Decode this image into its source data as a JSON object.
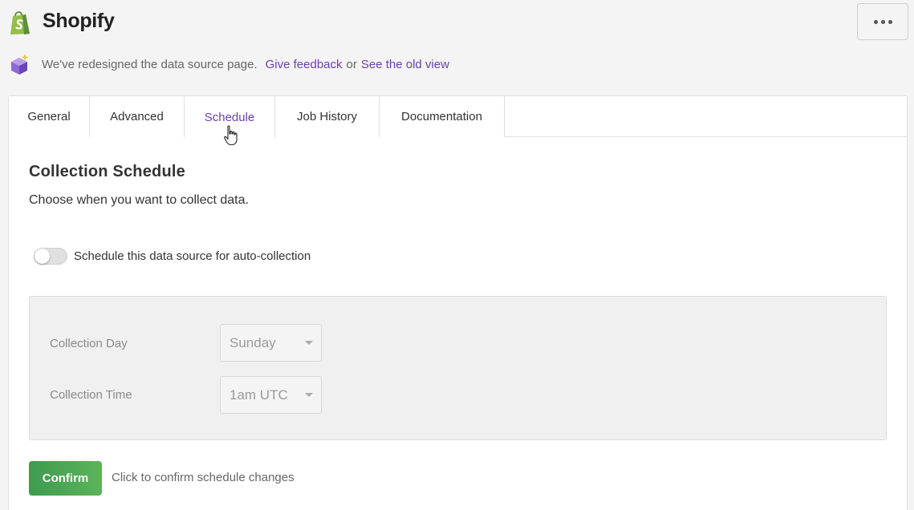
{
  "header": {
    "title": "Shopify",
    "logo_icon": "shopify-bag-icon",
    "more_icon": "ellipsis-icon"
  },
  "notice": {
    "text": "We've redesigned the data source page.",
    "feedback_link": "Give feedback",
    "or_text": "or",
    "old_view_link": "See the old view",
    "icon": "package-sparkle-icon"
  },
  "tabs": [
    {
      "label": "General"
    },
    {
      "label": "Advanced"
    },
    {
      "label": "Schedule",
      "active": true
    },
    {
      "label": "Job History"
    },
    {
      "label": "Documentation"
    }
  ],
  "schedule": {
    "title": "Collection Schedule",
    "description": "Choose when you want to collect data.",
    "toggle_label": "Schedule this data source for auto-collection",
    "toggle_on": false,
    "day_label": "Collection Day",
    "day_value": "Sunday",
    "time_label": "Collection Time",
    "time_value": "1am UTC",
    "confirm_label": "Confirm",
    "confirm_hint": "Click to confirm schedule changes"
  },
  "colors": {
    "link": "#6b3fb0",
    "confirm_green": "#4caa55",
    "brand_green": "#95bf47"
  }
}
